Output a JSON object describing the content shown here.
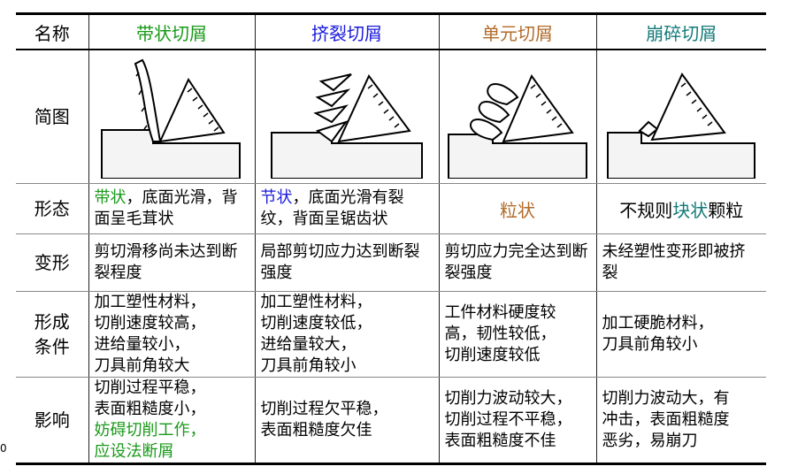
{
  "stray_text": "0",
  "columns": {
    "c0": "名称",
    "c1": "带状切屑",
    "c2": "挤裂切屑",
    "c3": "单元切屑",
    "c4": "崩碎切屑"
  },
  "colors": {
    "c1": "#1a9a1a",
    "c2": "#1a1adc",
    "c3": "#b26b2a",
    "c4": "#137a7a"
  },
  "rows": {
    "diagram": {
      "head": "简图"
    },
    "form": {
      "head": "形态",
      "c1_hl": "带状",
      "c1_rest": "，底面光滑，背面呈毛茸状",
      "c2_hl": "节状",
      "c2_rest": "，底面光滑有裂纹，背面呈锯齿状",
      "c3": "粒状",
      "c4_a": "不规则",
      "c4_hl": "块状",
      "c4_b": "颗粒"
    },
    "deform": {
      "head": "变形",
      "c1": "剪切滑移尚未达到断裂程度",
      "c2": "局部剪切应力达到断裂强度",
      "c3": "剪切应力完全达到断裂强度",
      "c4": "未经塑性变形即被挤裂"
    },
    "cond": {
      "head_a": "形成",
      "head_b": "条件",
      "c1": [
        "加工塑性材料，",
        "切削速度较高，",
        "进给量较小，",
        "刀具前角较大"
      ],
      "c2": [
        "加工塑性材料，",
        "切削速度较低，",
        "进给量较大，",
        "刀具前角较小"
      ],
      "c3": [
        "工件材料硬度较",
        "高，韧性较低，",
        "切削速度较低"
      ],
      "c4": [
        "加工硬脆材料，",
        "刀具前角较小"
      ]
    },
    "effect": {
      "head": "影响",
      "c1": [
        "切削过程平稳，",
        "表面粗糙度小，"
      ],
      "c1_green": [
        "妨碍切削工作，",
        "应设法断屑"
      ],
      "c2": [
        "切削过程欠平稳，",
        "表面粗糙度欠佳"
      ],
      "c3": [
        "切削力波动较大，",
        "切削过程不平稳，",
        "表面粗糙度不佳"
      ],
      "c4": [
        "切削力波动大，有",
        "冲击，表面粗糙度",
        "恶劣，易崩刀"
      ]
    }
  }
}
